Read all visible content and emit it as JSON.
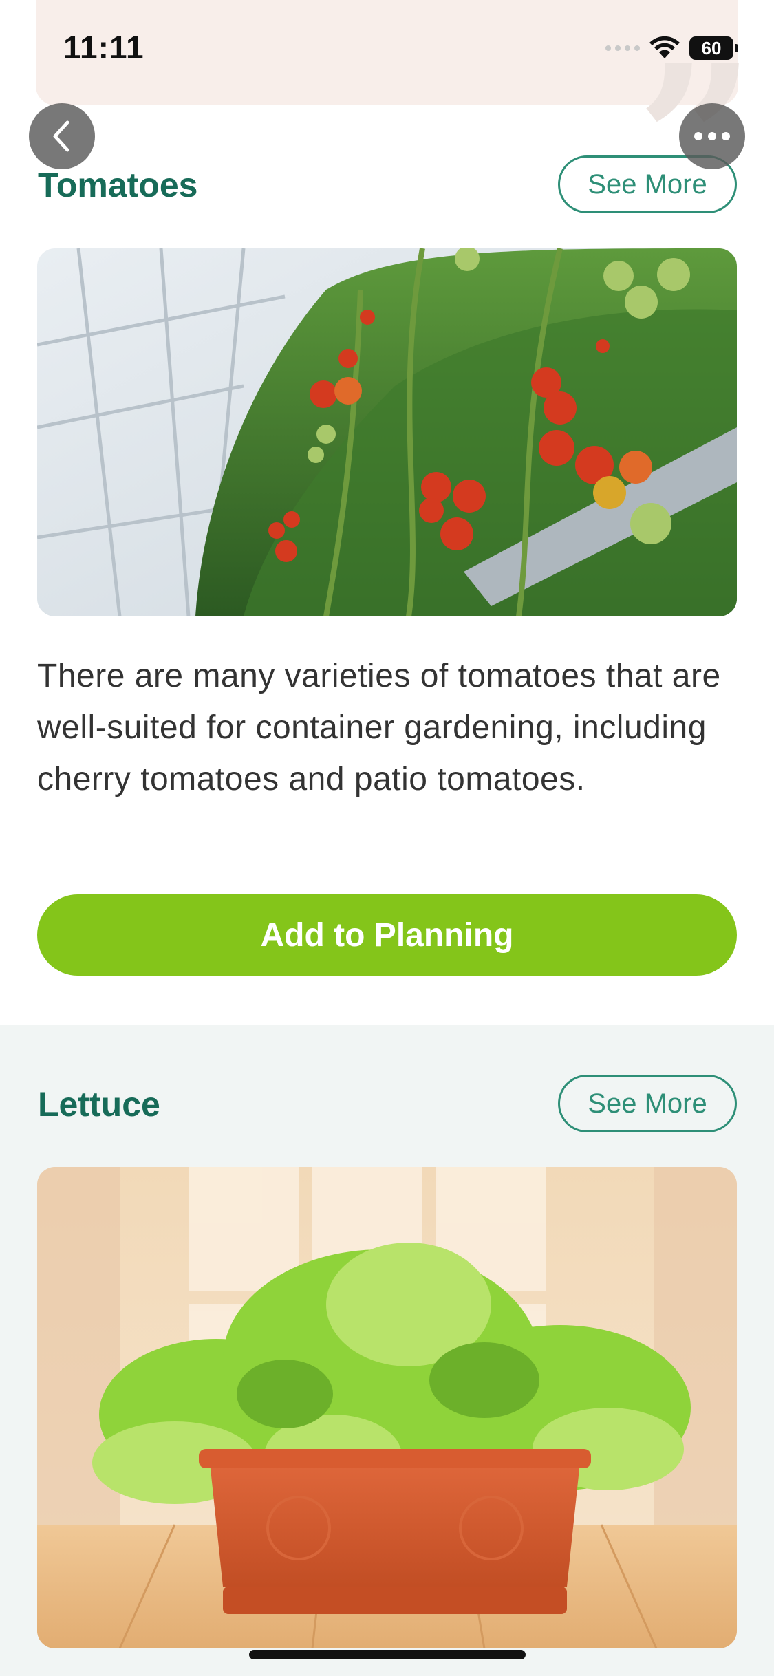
{
  "status_bar": {
    "time": "11:11",
    "battery": "60"
  },
  "nav": {
    "back_icon": "chevron-left-icon",
    "more_icon": "ellipsis-icon"
  },
  "sections": [
    {
      "title": "Tomatoes",
      "see_more_label": "See More",
      "description": "There are many varieties of tomatoes that are well-suited for container gardening, including cherry tomatoes and patio tomatoes.",
      "button_label": "Add to Planning"
    },
    {
      "title": "Lettuce",
      "see_more_label": "See More"
    }
  ],
  "colors": {
    "accent_green": "#84c51a",
    "title_green": "#176b58",
    "outline_green": "#2e8f77",
    "banner_bg": "#f8eeea",
    "section_bg_alt": "#f1f5f4"
  }
}
